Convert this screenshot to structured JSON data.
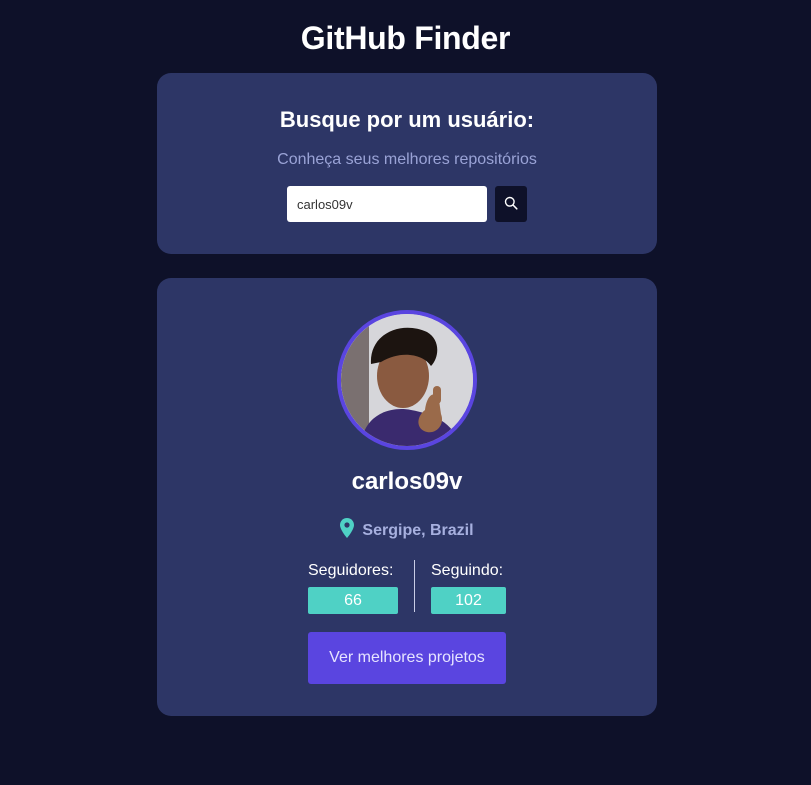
{
  "app": {
    "title": "GitHub Finder"
  },
  "search": {
    "heading": "Busque por um usuário:",
    "subtitle": "Conheça seus melhores repositórios",
    "input_value": "carlos09v",
    "button_icon": "search-icon"
  },
  "profile": {
    "avatar_icon": "avatar",
    "username": "carlos09v",
    "location_icon": "map-pin-icon",
    "location": "Sergipe, Brazil",
    "followers_label": "Seguidores:",
    "followers_count": "66",
    "following_label": "Seguindo:",
    "following_count": "102",
    "projects_button_label": "Ver melhores projetos"
  },
  "colors": {
    "background": "#0e1129",
    "card": "#2d3666",
    "accent_purple": "#5a45e0",
    "accent_teal": "#4fd1c5",
    "muted_text": "#9aa3d6"
  }
}
